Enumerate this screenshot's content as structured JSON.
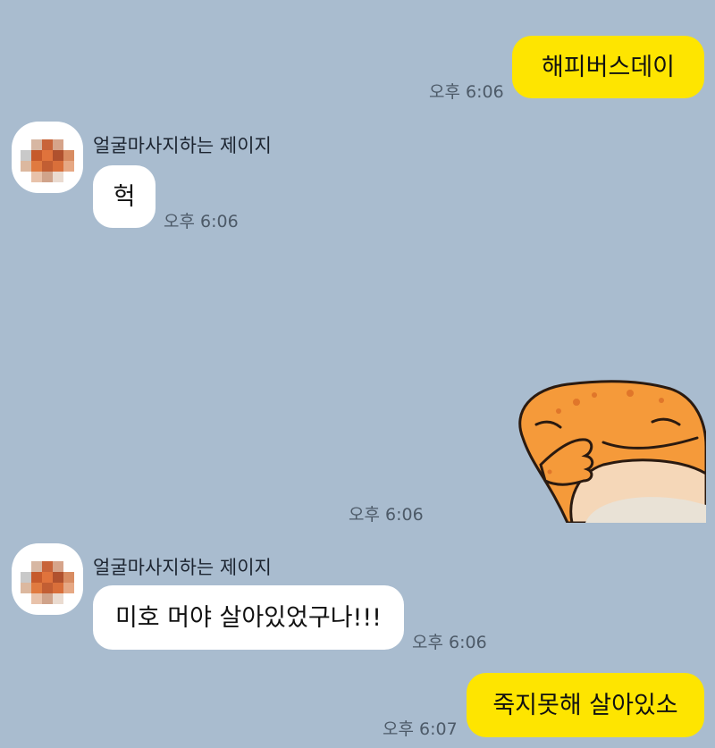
{
  "messages": [
    {
      "from": "me",
      "text": "해피버스데이",
      "time": "오후 6:06"
    },
    {
      "from": "other",
      "sender": "얼굴마사지하는 제이지",
      "text": "헉",
      "time": "오후 6:06"
    },
    {
      "from": "me",
      "type": "sticker",
      "sticker": "orange-gecko-sticker",
      "time": "오후 6:06"
    },
    {
      "from": "other",
      "sender": "얼굴마사지하는 제이지",
      "text": "미호 머야 살아있었구나!!!",
      "time": "오후 6:06"
    },
    {
      "from": "me",
      "text": "죽지못해 살아있소",
      "time": "오후 6:07"
    }
  ],
  "colors": {
    "background": "#a9bccf",
    "my_bubble": "#fee500",
    "other_bubble": "#ffffff",
    "timestamp": "#4d5a68"
  }
}
